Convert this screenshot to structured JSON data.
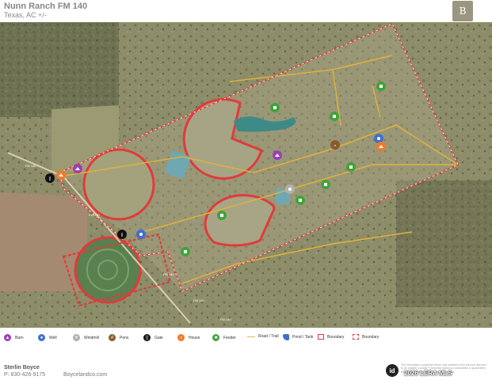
{
  "header": {
    "title": "Nunn Ranch FM 140",
    "subtitle": "Texas,  AC +/-",
    "logo_text": "B"
  },
  "map": {
    "road_labels": [
      "FM 140",
      "FM 140",
      "FM 140",
      "FM 140",
      "FM 140"
    ]
  },
  "scale": {
    "labels": [
      "0",
      "500",
      "1000",
      "1500",
      "2000ft"
    ]
  },
  "legend": {
    "items": [
      {
        "label": "Barn",
        "icon": "barn-icon",
        "color": "#9b3fb5"
      },
      {
        "label": "Well",
        "icon": "well-icon",
        "color": "#3f6fd1"
      },
      {
        "label": "Windmill",
        "icon": "windmill-icon",
        "color": "#b0b0b0"
      },
      {
        "label": "Pens",
        "icon": "pens-icon",
        "color": "#8b5a2b"
      },
      {
        "label": "Gate",
        "icon": "gate-icon",
        "color": "#111111"
      },
      {
        "label": "House",
        "icon": "house-icon",
        "color": "#f07a2a"
      },
      {
        "label": "Feeder",
        "icon": "feeder-icon",
        "color": "#3fa43a"
      },
      {
        "label": "Road / Trail",
        "icon": "road-icon",
        "color": "#e0b23a"
      },
      {
        "label": "Pond / Tank",
        "icon": "pond-icon",
        "color": "#3f6fd1"
      },
      {
        "label": "Boundary",
        "icon": "boundary-icon",
        "color": "#e23a3a"
      },
      {
        "label": "Boundary",
        "icon": "boundary-dashed-icon",
        "color": "#e23a3a"
      }
    ]
  },
  "footer": {
    "agent_name": "Sterlin Boyce",
    "agent_phone": "P: 830-426-9175",
    "agent_web": "Boycelandco.com",
    "disclaimer": "The information contained herein was obtained from sources deemed to be reliable. LandID™ Services makes no warranties or guarantees as to the completeness or accuracy thereof.",
    "watermark": "2026 LERA MLS"
  },
  "colors": {
    "boundary": "#e23a3a",
    "road": "#e0b23a",
    "pond": "#3f6fd1",
    "feeder": "#3fa43a"
  }
}
